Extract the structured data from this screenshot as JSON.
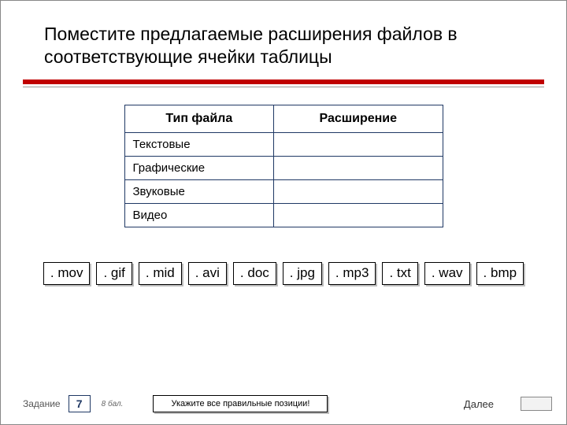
{
  "title": "Поместите предлагаемые расширения файлов в соответствующие ячейки таблицы",
  "table": {
    "header1": "Тип файла",
    "header2": "Расширение",
    "rows": [
      {
        "type": "Текстовые",
        "ext": ""
      },
      {
        "type": "Графические",
        "ext": ""
      },
      {
        "type": "Звуковые",
        "ext": ""
      },
      {
        "type": "Видео",
        "ext": ""
      }
    ]
  },
  "chips": [
    ". mov",
    ". gif",
    ". mid",
    ". avi",
    ". doc",
    ". jpg",
    ". mp3",
    ". txt",
    ". wav",
    ". bmp"
  ],
  "footer": {
    "task_label": "Задание",
    "task_number": "7",
    "score": "8 бал.",
    "hint": "Укажите все правильные позиции!",
    "next": "Далее"
  }
}
